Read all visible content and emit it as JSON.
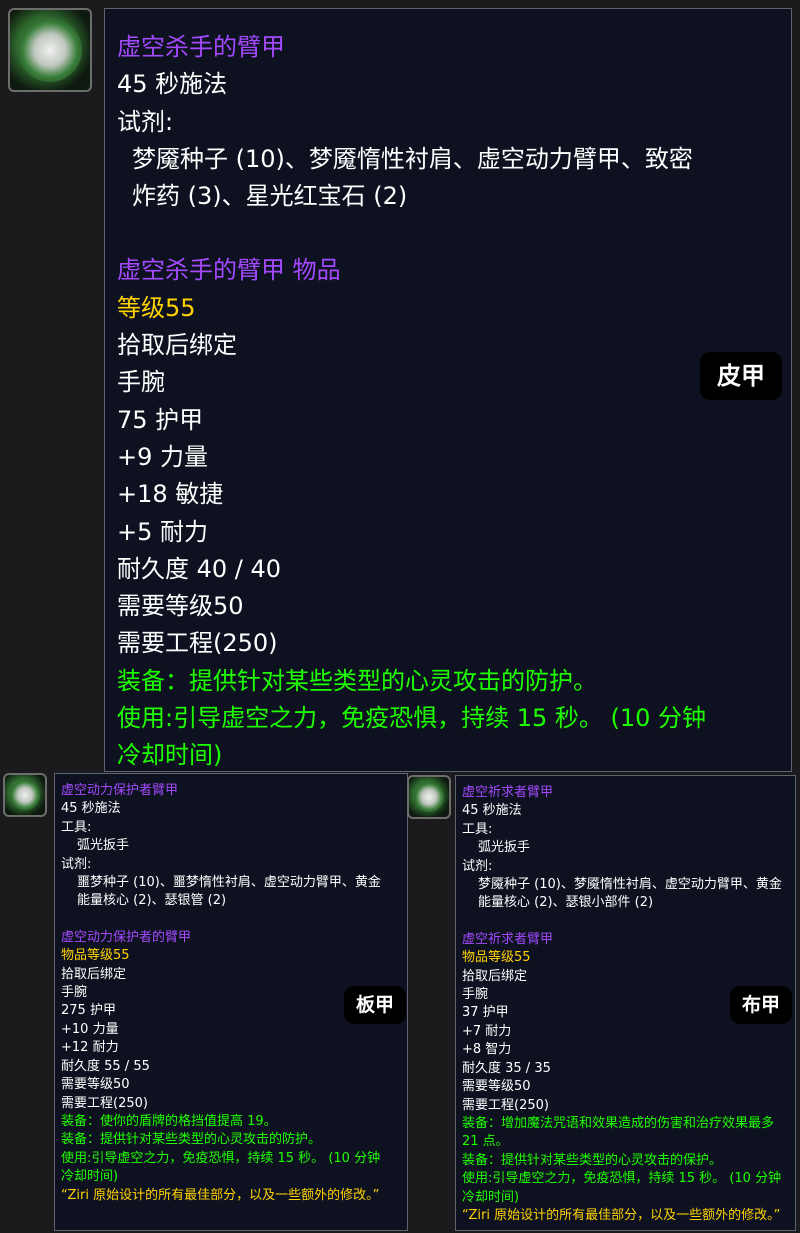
{
  "leather": {
    "title": "虚空杀手的臂甲",
    "cast": "45 秒施法",
    "reagents_label": "试剂:",
    "reagents_line1": "梦魇种子 (10)、梦魇惰性衬肩、虚空动力臂甲、致密",
    "reagents_line2": "炸药 (3)、星光红宝石 (2)",
    "item_name": "虚空杀手的臂甲 物品",
    "item_level": "等级55",
    "bind": "拾取后绑定",
    "slot": "手腕",
    "armor": "75 护甲",
    "stat1": "+9 力量",
    "stat2": "+18 敏捷",
    "stat3": "+5 耐力",
    "durability": "耐久度 40 / 40",
    "req_level": "需要等级50",
    "req_skill": "需要工程(250)",
    "equip1": "装备：提供针对某些类型的心灵攻击的防护。",
    "use_line1": "使用:引导虚空之力，免疫恐惧，持续 15 秒。 (10 分钟",
    "use_line2": "冷却时间)",
    "badge": "皮甲"
  },
  "plate": {
    "title": "虚空动力保护者臂甲",
    "cast": "45 秒施法",
    "tools_label": "工具:",
    "tool": "弧光扳手",
    "reagents_label": "试剂:",
    "reagents_line1": "噩梦种子 (10)、噩梦惰性衬肩、虚空动力臂甲、黄金",
    "reagents_line2": "能量核心 (2)、瑟银管 (2)",
    "item_name": "虚空动力保护者的臂甲",
    "item_level": "物品等级55",
    "bind": "拾取后绑定",
    "slot": "手腕",
    "armor": "275 护甲",
    "stat1": "+10 力量",
    "stat2": "+12 耐力",
    "durability": "耐久度 55 / 55",
    "req_level": "需要等级50",
    "req_skill": "需要工程(250)",
    "equip1": "装备：使你的盾牌的格挡值提高 19。",
    "equip2": "装备：提供针对某些类型的心灵攻击的防护。",
    "use_line1": "使用:引导虚空之力，免疫恐惧，持续 15 秒。 (10 分钟",
    "use_line2": "冷却时间)",
    "flavor": "“Ziri 原始设计的所有最佳部分，以及一些额外的修改。”",
    "badge": "板甲"
  },
  "cloth": {
    "title": "虚空祈求者臂甲",
    "cast": "45 秒施法",
    "tools_label": "工具:",
    "tool": "弧光扳手",
    "reagents_label": "试剂:",
    "reagents_line1": "梦魇种子 (10)、梦魇惰性衬肩、虚空动力臂甲、黄金",
    "reagents_line2": "能量核心 (2)、瑟银小部件 (2)",
    "item_name": "虚空祈求者臂甲",
    "item_level": "物品等级55",
    "bind": "拾取后绑定",
    "slot": "手腕",
    "armor": "37 护甲",
    "stat1": "+7 耐力",
    "stat2": "+8 智力",
    "durability": "耐久度 35 / 35",
    "req_level": "需要等级50",
    "req_skill": "需要工程(250)",
    "equip1_line1": "装备：增加魔法咒语和效果造成的伤害和治疗效果最多",
    "equip1_line2": "21 点。",
    "equip2": "装备：提供针对某些类型的心灵攻击的保护。",
    "use_line1": "使用:引导虚空之力，免疫恐惧，持续 15 秒。 (10 分钟",
    "use_line2": "冷却时间)",
    "flavor": "“Ziri 原始设计的所有最佳部分，以及一些额外的修改。”",
    "badge": "布甲"
  }
}
